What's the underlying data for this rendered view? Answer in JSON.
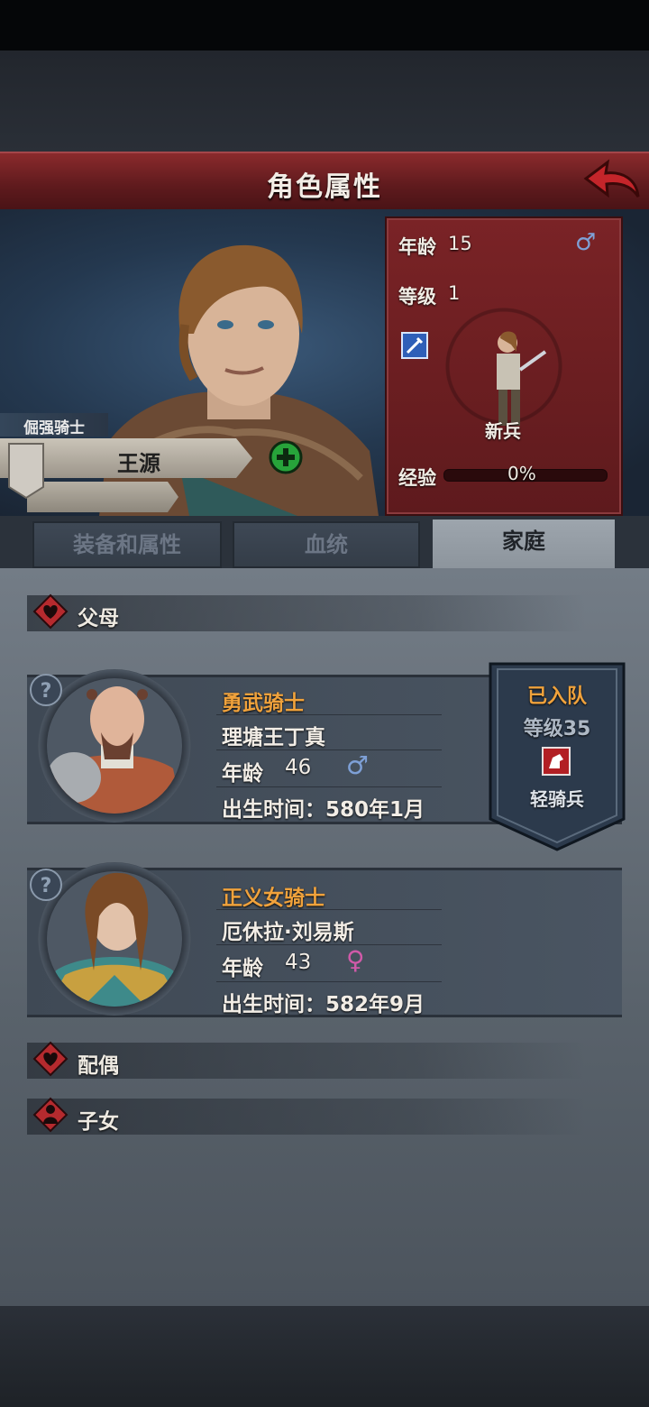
{
  "header": {
    "title": "角色属性"
  },
  "character": {
    "title": "倔强骑士",
    "name": "王源",
    "age_label": "年龄",
    "age": "15",
    "level_label": "等级",
    "level": "1",
    "unit": "新兵",
    "exp_label": "经验",
    "exp_percent": "0%",
    "exp_fraction": 0
  },
  "tabs": [
    {
      "label": "装备和属性",
      "active": false
    },
    {
      "label": "血统",
      "active": false
    },
    {
      "label": "家庭",
      "active": true
    }
  ],
  "family": {
    "parents_label": "父母",
    "spouse_label": "配偶",
    "children_label": "子女",
    "parents": [
      {
        "title": "勇武骑士",
        "name": "理塘王丁真",
        "age_label": "年龄",
        "age": "46",
        "gender": "male",
        "birth": "出生时间：580年1月",
        "status": "已入队",
        "level": "等级35",
        "unit": "轻骑兵"
      },
      {
        "title": "正义女骑士",
        "name": "厄休拉·刘易斯",
        "age_label": "年龄",
        "age": "43",
        "gender": "female",
        "birth": "出生时间：582年9月"
      }
    ]
  },
  "icons": {
    "male": "♂",
    "female": "♀",
    "help": "?",
    "add": "+"
  },
  "colors": {
    "title_bar": "#6e2023",
    "accent_orange": "#f0a23c",
    "male_blue": "#7ea0d6",
    "female_pink": "#d05aa8",
    "add_green": "#27a33a"
  }
}
